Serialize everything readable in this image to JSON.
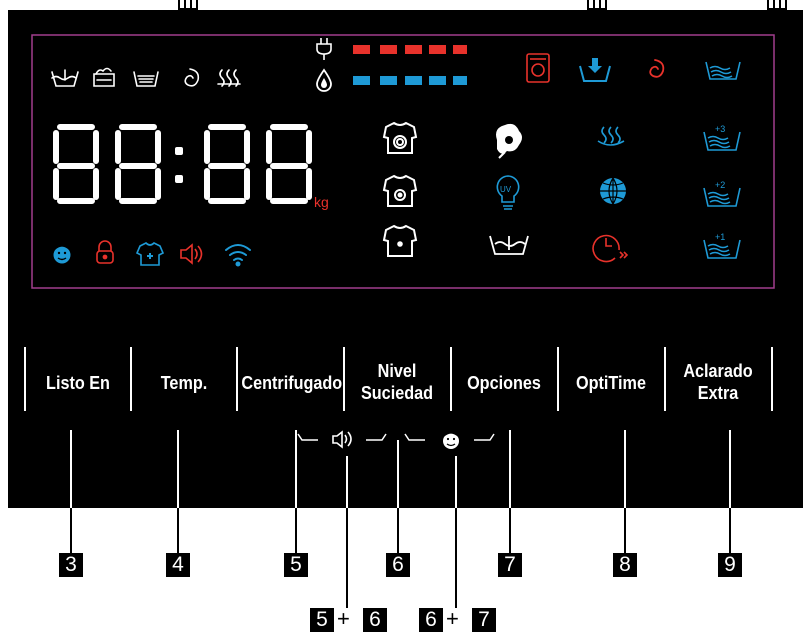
{
  "display": {
    "weight_unit": "kg",
    "rinse_levels": [
      "+3",
      "+2",
      "+1"
    ],
    "uv_label": "UV"
  },
  "buttons": [
    {
      "id": "listo-en",
      "line1": "Listo En",
      "line2": "",
      "number": "3"
    },
    {
      "id": "temp",
      "line1": "Temp.",
      "line2": "",
      "number": "4"
    },
    {
      "id": "centrifugado",
      "line1": "Centrifugado",
      "line2": "",
      "number": "5"
    },
    {
      "id": "nivel-suciedad",
      "line1": "Nivel",
      "line2": "Suciedad",
      "number": "6"
    },
    {
      "id": "opciones",
      "line1": "Opciones",
      "line2": "",
      "number": "7"
    },
    {
      "id": "optitime",
      "line1": "OptiTime",
      "line2": "",
      "number": "8"
    },
    {
      "id": "aclarado-extra",
      "line1": "Aclarado",
      "line2": "Extra",
      "number": "9"
    }
  ],
  "combos": [
    {
      "a": "5",
      "op": "+",
      "b": "6"
    },
    {
      "a": "6",
      "op": "+",
      "b": "7"
    }
  ],
  "colors": {
    "red": "#e8322b",
    "blue": "#1e9ad6",
    "white": "#ffffff",
    "border": "#a13d8e"
  }
}
